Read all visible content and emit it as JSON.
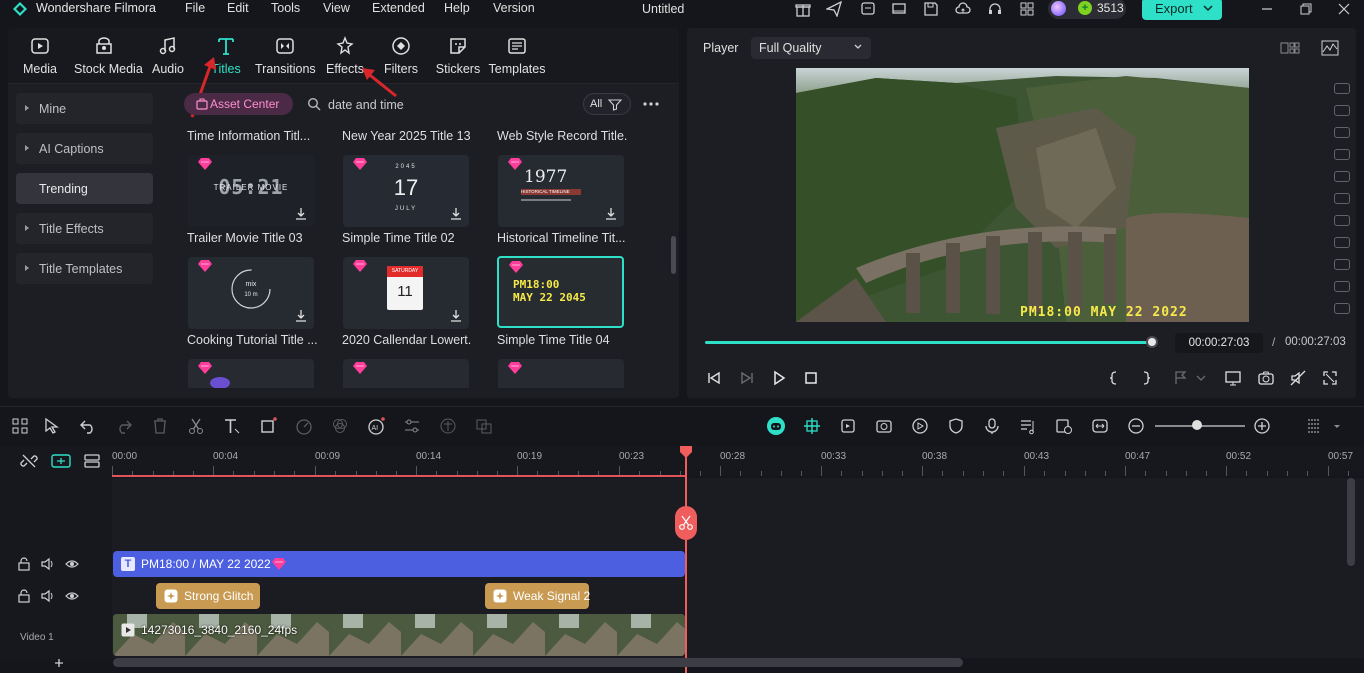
{
  "app": {
    "name": "Wondershare Filmora",
    "document_title": "Untitled",
    "menu": [
      "File",
      "Edit",
      "Tools",
      "View",
      "Extended",
      "Help",
      "Version"
    ],
    "credits": "3513",
    "export_label": "Export",
    "accent": "#2ee0c8"
  },
  "library": {
    "tabs": [
      {
        "label": "Media",
        "icon": "media-icon"
      },
      {
        "label": "Stock Media",
        "icon": "stock-media-icon"
      },
      {
        "label": "Audio",
        "icon": "audio-icon"
      },
      {
        "label": "Titles",
        "icon": "titles-icon",
        "active": true
      },
      {
        "label": "Transitions",
        "icon": "transitions-icon"
      },
      {
        "label": "Effects",
        "icon": "effects-icon"
      },
      {
        "label": "Filters",
        "icon": "filters-icon"
      },
      {
        "label": "Stickers",
        "icon": "stickers-icon"
      },
      {
        "label": "Templates",
        "icon": "templates-icon"
      }
    ],
    "sidebar": [
      {
        "label": "Mine"
      },
      {
        "label": "AI Captions"
      },
      {
        "label": "Trending",
        "active": true
      },
      {
        "label": "Title Effects"
      },
      {
        "label": "Title Templates"
      }
    ],
    "asset_center_label": "Asset Center",
    "search_value": "date and time",
    "filter_label": "All",
    "top_row_titles": [
      "Time Information Titl...",
      "New Year 2025 Title 13",
      "Web Style Record Title..."
    ],
    "cards": [
      {
        "title": "Trailer Movie Title 03",
        "thumb_text": "05:21",
        "thumb_sub": "TRAILER MOVIE"
      },
      {
        "title": "Simple Time Title 02",
        "thumb_text": "17",
        "thumb_top": "2045",
        "thumb_sub": "JULY"
      },
      {
        "title": "Historical Timeline Tit...",
        "thumb_text": "1977",
        "thumb_sub": "HISTORICAL TIMELINE"
      },
      {
        "title": "Cooking Tutorial Title ...",
        "thumb_text": "mix",
        "thumb_sub": "10 m"
      },
      {
        "title": "2020 Callendar Lowert...",
        "thumb_text": "11",
        "thumb_top": "SATURDAY"
      },
      {
        "title": "Simple Time Title 04",
        "thumb_text": "PM18:00",
        "thumb_sub": "MAY 22 2045",
        "selected": true
      }
    ]
  },
  "player": {
    "label": "Player",
    "quality": "Full Quality",
    "video_stamp": "PM18:00  MAY 22 2022",
    "progress": 1.0,
    "current_time": "00:00:27:03",
    "separator": "/",
    "total_time": "00:00:27:03"
  },
  "timeline": {
    "ruler": [
      "00:00",
      "00:04",
      "00:09",
      "00:14",
      "00:19",
      "00:23",
      "00:28",
      "00:33",
      "00:38",
      "00:43",
      "00:47",
      "00:52",
      "00:57"
    ],
    "title_clip": "PM18:00 / MAY 22 2022",
    "effect_clips": [
      "Strong Glitch",
      "Weak Signal 2"
    ],
    "video_clip": "14273016_3840_2160_24fps",
    "video_track_label": "Video 1"
  }
}
